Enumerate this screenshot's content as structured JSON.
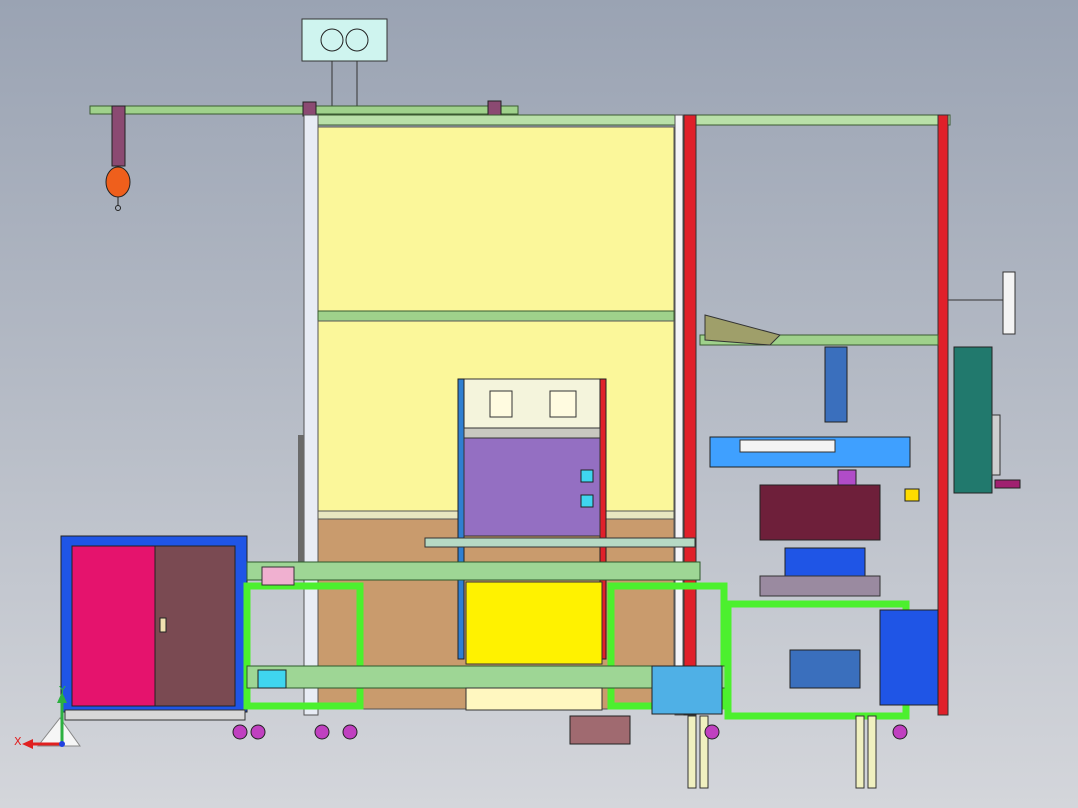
{
  "view_triad": {
    "x_label": "X",
    "y_label": "Y"
  },
  "colors": {
    "frame_yellow": "#fbf79a",
    "frame_red": "#e0202a",
    "frame_green": "#4cf02e",
    "cabinet_blue": "#1f55e6",
    "cabinet_pink": "#e5136d",
    "cabinet_maroon": "#7a4a52",
    "panel_purple": "#946fc2",
    "panel_tan": "#c99b6d",
    "cyan": "#3fd5ef",
    "teal": "#21796d",
    "ground_yellow": "#fff200"
  }
}
